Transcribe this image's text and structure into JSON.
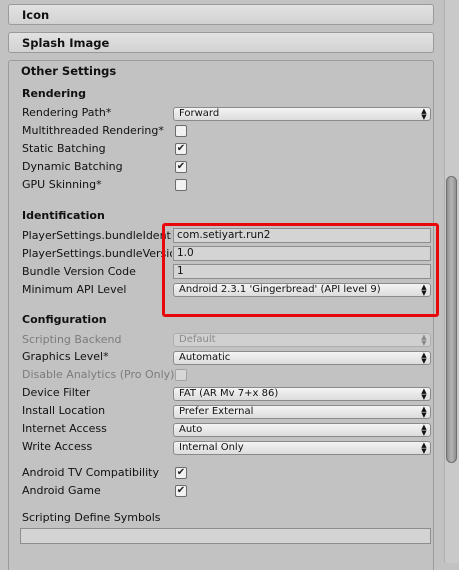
{
  "foldouts": {
    "icon": "Icon",
    "splash": "Splash Image",
    "other": "Other Settings"
  },
  "rendering": {
    "title": "Rendering",
    "rendering_path_label": "Rendering Path*",
    "rendering_path_value": "Forward",
    "multithreaded_label": "Multithreaded Rendering*",
    "multithreaded_checked": false,
    "static_batching_label": "Static Batching",
    "static_batching_checked": true,
    "dynamic_batching_label": "Dynamic Batching",
    "dynamic_batching_checked": true,
    "gpu_skinning_label": "GPU Skinning*",
    "gpu_skinning_checked": false
  },
  "identification": {
    "title": "Identification",
    "bundle_identifier_label": "PlayerSettings.bundleIdentifier",
    "bundle_identifier_value": "com.setiyart.run2",
    "bundle_version_label": "PlayerSettings.bundleVersion",
    "bundle_version_value": "1.0",
    "bundle_version_code_label": "Bundle Version Code",
    "bundle_version_code_value": "1",
    "min_api_label": "Minimum API Level",
    "min_api_value": "Android 2.3.1 'Gingerbread' (API level 9)"
  },
  "configuration": {
    "title": "Configuration",
    "scripting_backend_label": "Scripting Backend",
    "scripting_backend_value": "Default",
    "graphics_level_label": "Graphics Level*",
    "graphics_level_value": "Automatic",
    "disable_analytics_label": "Disable Analytics (Pro Only)",
    "disable_analytics_checked": false,
    "device_filter_label": "Device Filter",
    "device_filter_value": "FAT (AR Mv 7+x 86)",
    "install_location_label": "Install Location",
    "install_location_value": "Prefer External",
    "internet_access_label": "Internet Access",
    "internet_access_value": "Auto",
    "write_access_label": "Write Access",
    "write_access_value": "Internal Only",
    "android_tv_label": "Android TV Compatibility",
    "android_tv_checked": true,
    "android_game_label": "Android Game",
    "android_game_checked": true,
    "scripting_define_label": "Scripting Define Symbols",
    "scripting_define_value": ""
  },
  "check_glyph": "✔",
  "colors": {
    "highlight_box": "#e8080c",
    "panel_bg": "#c2c2c2"
  }
}
